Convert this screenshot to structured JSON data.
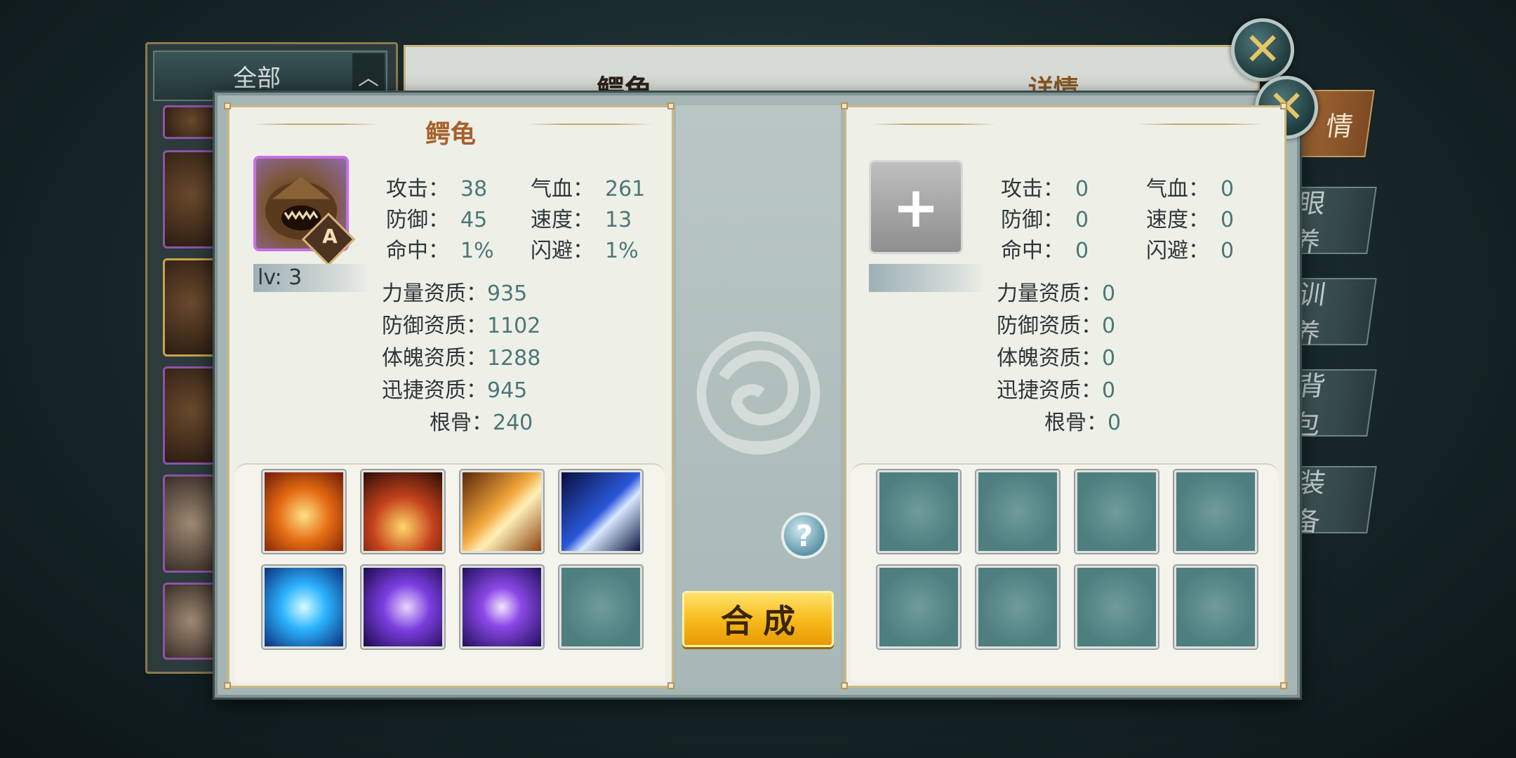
{
  "background": {
    "sidebar_filter": "全部",
    "panel_title": "鳄龟",
    "detail_title": "详情",
    "tabs": [
      "情",
      "眼 养",
      "训 养",
      "背 包",
      "装 备"
    ]
  },
  "left_pet": {
    "name": "鳄龟",
    "rank": "A",
    "level": "lv: 3",
    "stats": [
      {
        "label": "攻击：",
        "value": "38"
      },
      {
        "label": "气血：",
        "value": "261"
      },
      {
        "label": "防御：",
        "value": "45"
      },
      {
        "label": "速度：",
        "value": "13"
      },
      {
        "label": "命中：",
        "value": "1%"
      },
      {
        "label": "闪避：",
        "value": "1%"
      }
    ],
    "aptitudes": [
      {
        "label": "力量资质：",
        "value": "935"
      },
      {
        "label": "防御资质：",
        "value": "1102"
      },
      {
        "label": "体魄资质：",
        "value": "1288"
      },
      {
        "label": "迅捷资质：",
        "value": "945"
      },
      {
        "label": "根骨：",
        "value": "240"
      }
    ],
    "skills": [
      "fire-shield-skill-icon",
      "turtle-fire-skill-icon",
      "golden-claw-skill-icon",
      "blue-slash-skill-icon",
      "ice-wolf-skill-icon",
      "purple-vortex-skill-icon",
      "purple-whirl-skill-icon",
      "empty-skill-slot"
    ]
  },
  "right_pet": {
    "plus_symbol": "+",
    "stats": [
      {
        "label": "攻击：",
        "value": "0"
      },
      {
        "label": "气血：",
        "value": "0"
      },
      {
        "label": "防御：",
        "value": "0"
      },
      {
        "label": "速度：",
        "value": "0"
      },
      {
        "label": "命中：",
        "value": "0"
      },
      {
        "label": "闪避：",
        "value": "0"
      }
    ],
    "aptitudes": [
      {
        "label": "力量资质：",
        "value": "0"
      },
      {
        "label": "防御资质：",
        "value": "0"
      },
      {
        "label": "体魄资质：",
        "value": "0"
      },
      {
        "label": "迅捷资质：",
        "value": "0"
      },
      {
        "label": "根骨：",
        "value": "0"
      }
    ]
  },
  "center": {
    "help_symbol": "?",
    "merge_button": "合成"
  },
  "close_symbol": "✕",
  "colors": {
    "accent_gold": "#f7b819",
    "title_brown": "#a7612c",
    "value_teal": "#4b7777",
    "rank_purple": "#c86fe3"
  }
}
